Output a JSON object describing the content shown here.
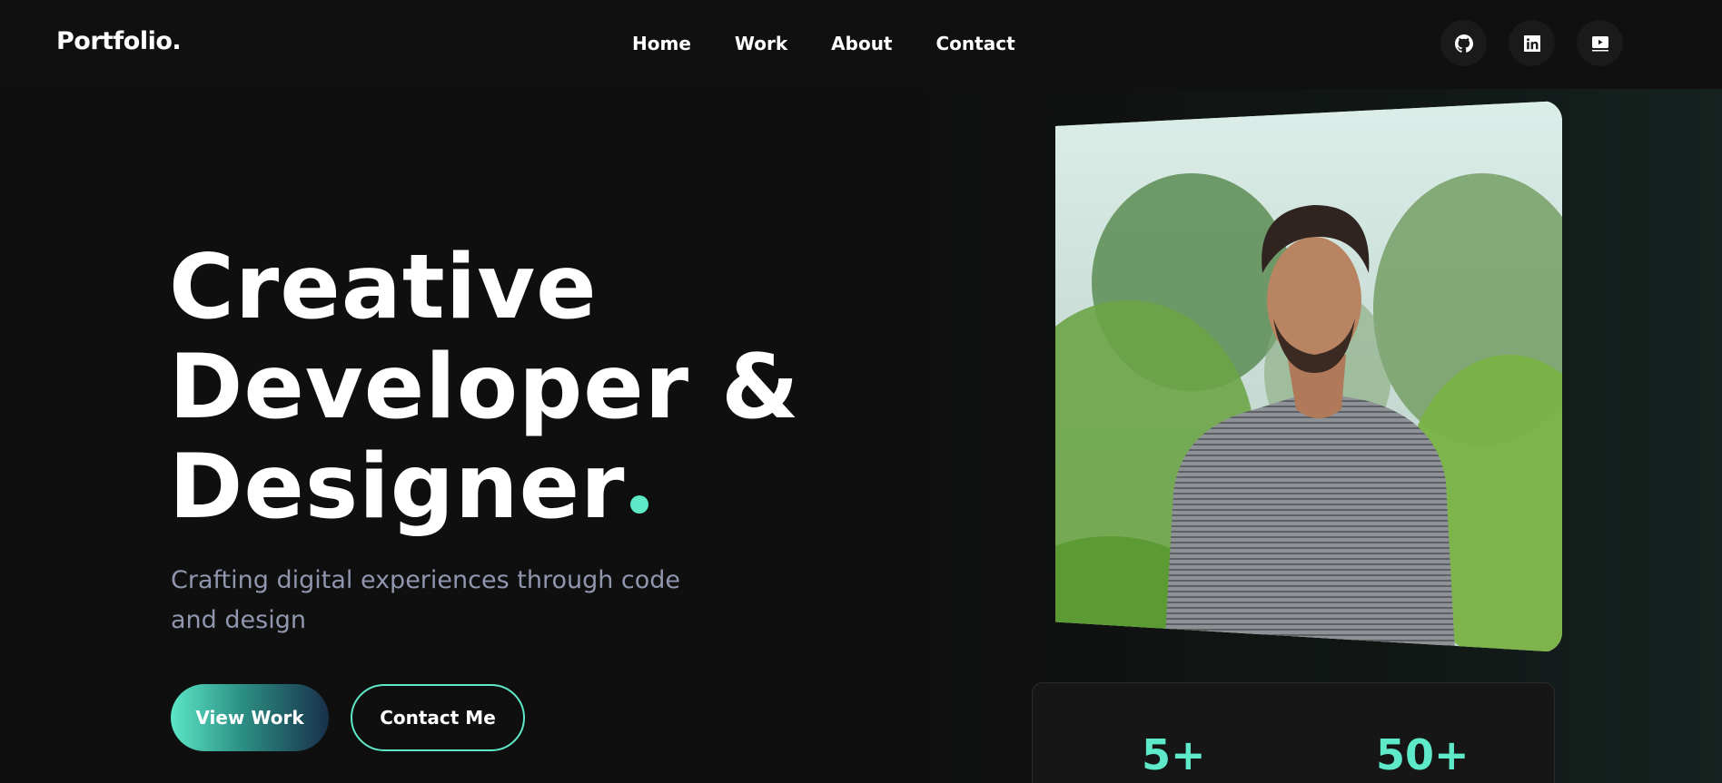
{
  "brand": {
    "logo": "Portfolio."
  },
  "nav": {
    "links": [
      "Home",
      "Work",
      "About",
      "Contact"
    ]
  },
  "social": [
    {
      "icon": "github-icon"
    },
    {
      "icon": "linkedin-icon"
    },
    {
      "icon": "youtube-icon"
    }
  ],
  "hero": {
    "title_lines": [
      "Creative",
      "Developer &",
      "Designer"
    ],
    "subtitle": "Crafting digital experiences through code and design",
    "primary_button": "View Work",
    "secondary_button": "Contact Me"
  },
  "stats": [
    {
      "value": "5+"
    },
    {
      "value": "50+"
    }
  ],
  "colors": {
    "accent": "#5ee9c8",
    "background": "#0f0f0f",
    "muted_text": "#8f96ad"
  }
}
